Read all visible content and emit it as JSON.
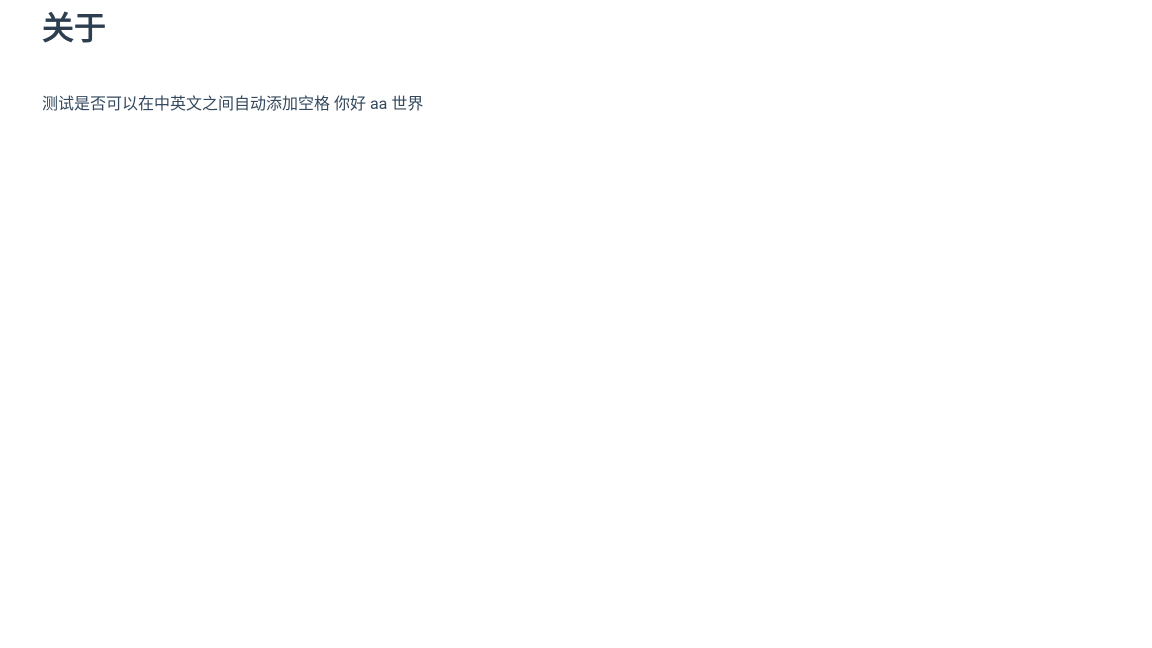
{
  "page": {
    "heading": "关于",
    "paragraph": "测试是否可以在中英文之间自动添加空格 你好 aa 世界"
  }
}
